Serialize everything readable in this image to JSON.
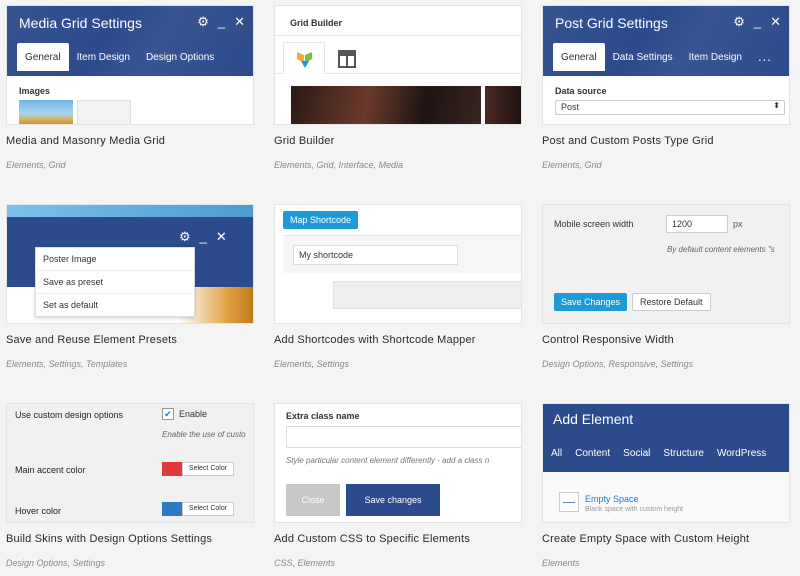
{
  "cards": [
    {
      "title": "Media and Masonry Media Grid",
      "tags": "Elements, Grid",
      "panel": {
        "title": "Media Grid Settings",
        "tabs": [
          "General",
          "Item Design",
          "Design Options"
        ],
        "images_label": "Images"
      }
    },
    {
      "title": "Grid Builder",
      "tags": "Elements, Grid, Interface, Media",
      "panel": {
        "header": "Grid Builder"
      }
    },
    {
      "title": "Post and Custom Posts Type Grid",
      "tags": "Elements, Grid",
      "panel": {
        "title": "Post Grid Settings",
        "tabs": [
          "General",
          "Data Settings",
          "Item Design"
        ],
        "more": "...",
        "data_source_label": "Data source",
        "data_source_value": "Post"
      }
    },
    {
      "title": "Save and Reuse Element Presets",
      "tags": "Elements, Settings, Templates",
      "panel": {
        "menu": [
          "Poster Image",
          "Save as preset",
          "Set as default"
        ]
      }
    },
    {
      "title": "Add Shortcodes with Shortcode Mapper",
      "tags": "Elements, Settings",
      "panel": {
        "button": "Map Shortcode",
        "input_value": "My shortcode"
      }
    },
    {
      "title": "Control Responsive Width",
      "tags": "Design Options, Responsive, Settings",
      "panel": {
        "label": "Mobile screen width",
        "value": "1200",
        "unit": "px",
        "description": "By default content elements \"s",
        "save": "Save Changes",
        "restore": "Restore Default"
      }
    },
    {
      "title": "Build Skins with Design Options Settings",
      "tags": "Design Options, Settings",
      "panel": {
        "custom_label": "Use custom design options",
        "enable": "Enable",
        "enable_desc": "Enable the use of custo",
        "accent_label": "Main accent color",
        "hover_label": "Hover color",
        "select_color": "Select Color",
        "accent_color": "#e0393b",
        "hover_color": "#2a7bc4"
      }
    },
    {
      "title": "Add Custom CSS to Specific Elements",
      "tags": "CSS, Elements",
      "panel": {
        "label": "Extra class name",
        "description": "Style particular content element differently - add a class n",
        "close": "Close",
        "save": "Save changes"
      }
    },
    {
      "title": "Create Empty Space with Custom Height",
      "tags": "Elements",
      "panel": {
        "title": "Add Element",
        "tabs": [
          "All",
          "Content",
          "Social",
          "Structure",
          "WordPress"
        ],
        "element_name": "Empty Space",
        "element_desc": "Blank space with custom height"
      }
    }
  ],
  "colors": {
    "panel_blue": "#2c4b8c",
    "accent_blue": "#1c9bd8"
  }
}
